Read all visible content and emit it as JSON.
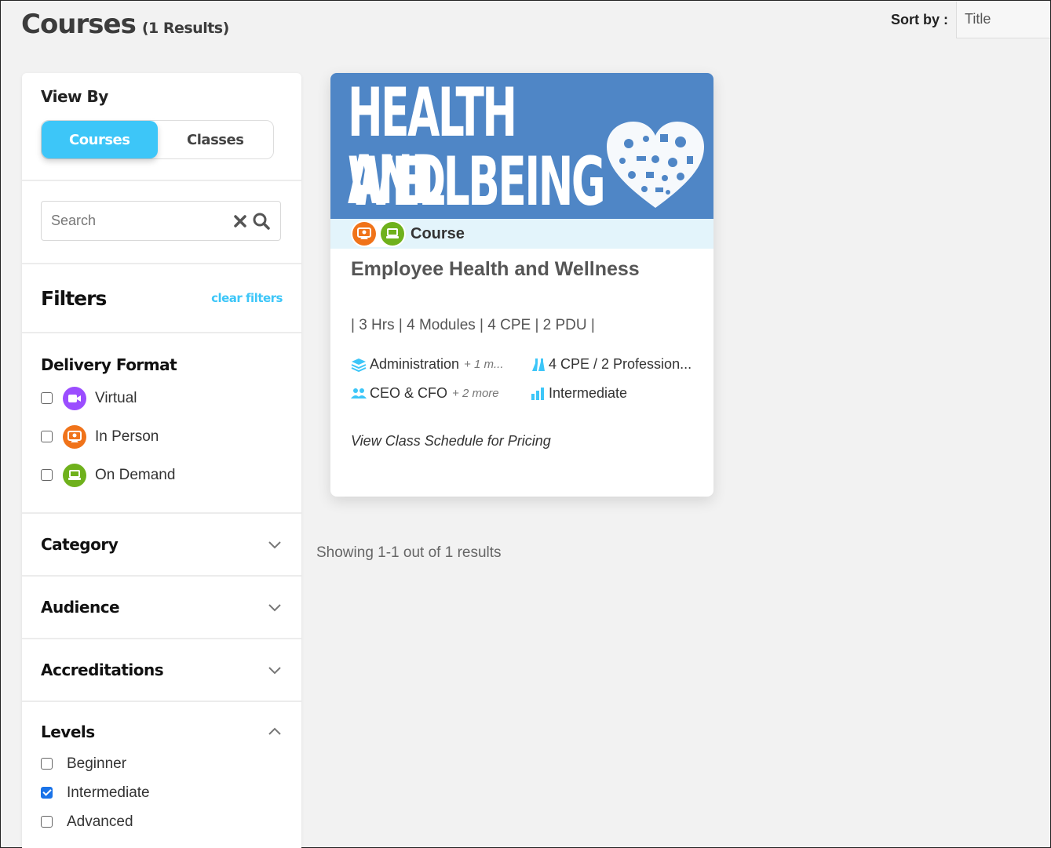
{
  "header": {
    "title": "Courses",
    "count": "(1 Results)"
  },
  "sort": {
    "label": "Sort by :",
    "value": "Title"
  },
  "sidebar": {
    "view_by": {
      "title": "View By",
      "options": [
        "Courses",
        "Classes"
      ],
      "active": "Courses"
    },
    "search": {
      "placeholder": "Search"
    },
    "filters": {
      "title": "Filters",
      "clear_label": "clear filters"
    },
    "delivery_format": {
      "title": "Delivery Format",
      "options": [
        {
          "label": "Virtual",
          "checked": false,
          "color": "#9b4dff",
          "icon": "video-camera-icon"
        },
        {
          "label": "In Person",
          "checked": false,
          "color": "#f0731a",
          "icon": "person-presenter-icon"
        },
        {
          "label": "On Demand",
          "checked": false,
          "color": "#6fb11c",
          "icon": "laptop-icon"
        }
      ]
    },
    "category": {
      "title": "Category"
    },
    "audience": {
      "title": "Audience"
    },
    "accreditations": {
      "title": "Accreditations"
    },
    "levels": {
      "title": "Levels",
      "options": [
        {
          "label": "Beginner",
          "checked": false
        },
        {
          "label": "Intermediate",
          "checked": true
        },
        {
          "label": "Advanced",
          "checked": false
        }
      ]
    }
  },
  "course_card": {
    "banner": {
      "line1": "HEALTH AND",
      "line2": "WELLBEING",
      "bg_color": "#4f86c6"
    },
    "type_label": "Course",
    "title": "Employee Health and Wellness",
    "meta": "| 3 Hrs | 4 Modules | 4 CPE | 2 PDU |",
    "attributes": {
      "category": {
        "text": "Administration",
        "more": "+ 1 m..."
      },
      "credits": {
        "text": "4 CPE / 2 Profession..."
      },
      "audience": {
        "text": "CEO & CFO",
        "more": "+ 2 more"
      },
      "level": {
        "text": "Intermediate"
      }
    },
    "pricing": "View Class Schedule for Pricing"
  },
  "results": "Showing 1-1 out of 1 results",
  "colors": {
    "accent": "#3dc6f8"
  }
}
